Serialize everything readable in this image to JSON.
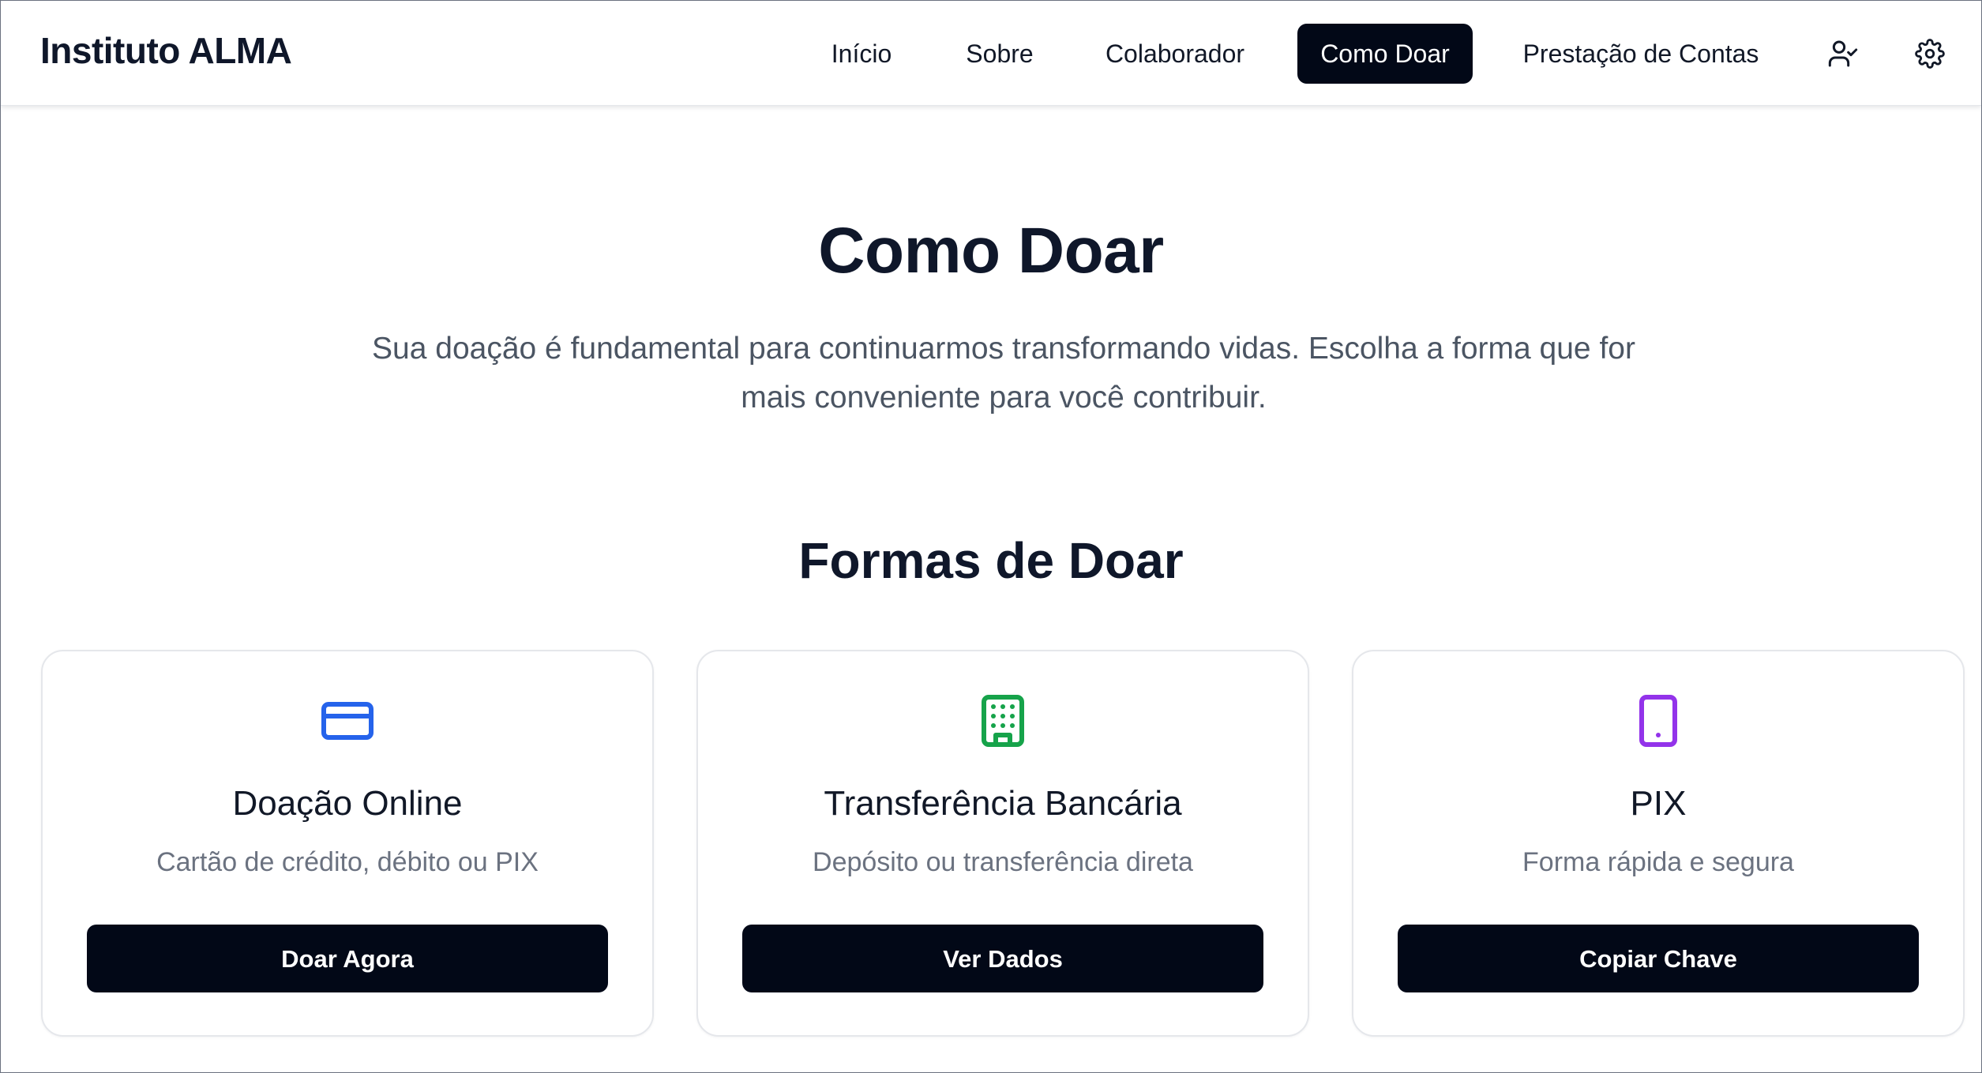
{
  "header": {
    "brand": "Instituto ALMA",
    "nav": [
      {
        "label": "Início"
      },
      {
        "label": "Sobre"
      },
      {
        "label": "Colaborador"
      },
      {
        "label": "Como Doar",
        "active": true
      },
      {
        "label": "Prestação de Contas"
      }
    ],
    "icons": [
      "user-check-icon",
      "gear-icon"
    ]
  },
  "hero": {
    "title": "Como Doar",
    "subtitle_line1": "Sua doação é fundamental para continuarmos transformando vidas. Escolha a forma que for",
    "subtitle_line2": "mais conveniente para você contribuir."
  },
  "section": {
    "title": "Formas de Doar"
  },
  "cards": [
    {
      "icon": "credit-card-icon",
      "icon_color": "#2563eb",
      "title": "Doação Online",
      "description": "Cartão de crédito, débito ou PIX",
      "button": "Doar Agora"
    },
    {
      "icon": "building-icon",
      "icon_color": "#16a34a",
      "title": "Transferência Bancária",
      "description": "Depósito ou transferência direta",
      "button": "Ver Dados"
    },
    {
      "icon": "smartphone-icon",
      "icon_color": "#9333ea",
      "title": "PIX",
      "description": "Forma rápida e segura",
      "button": "Copiar Chave"
    }
  ],
  "colors": {
    "primary": "#020817",
    "text": "#0f172a",
    "muted": "#6b7280",
    "border": "#e5e7eb"
  }
}
